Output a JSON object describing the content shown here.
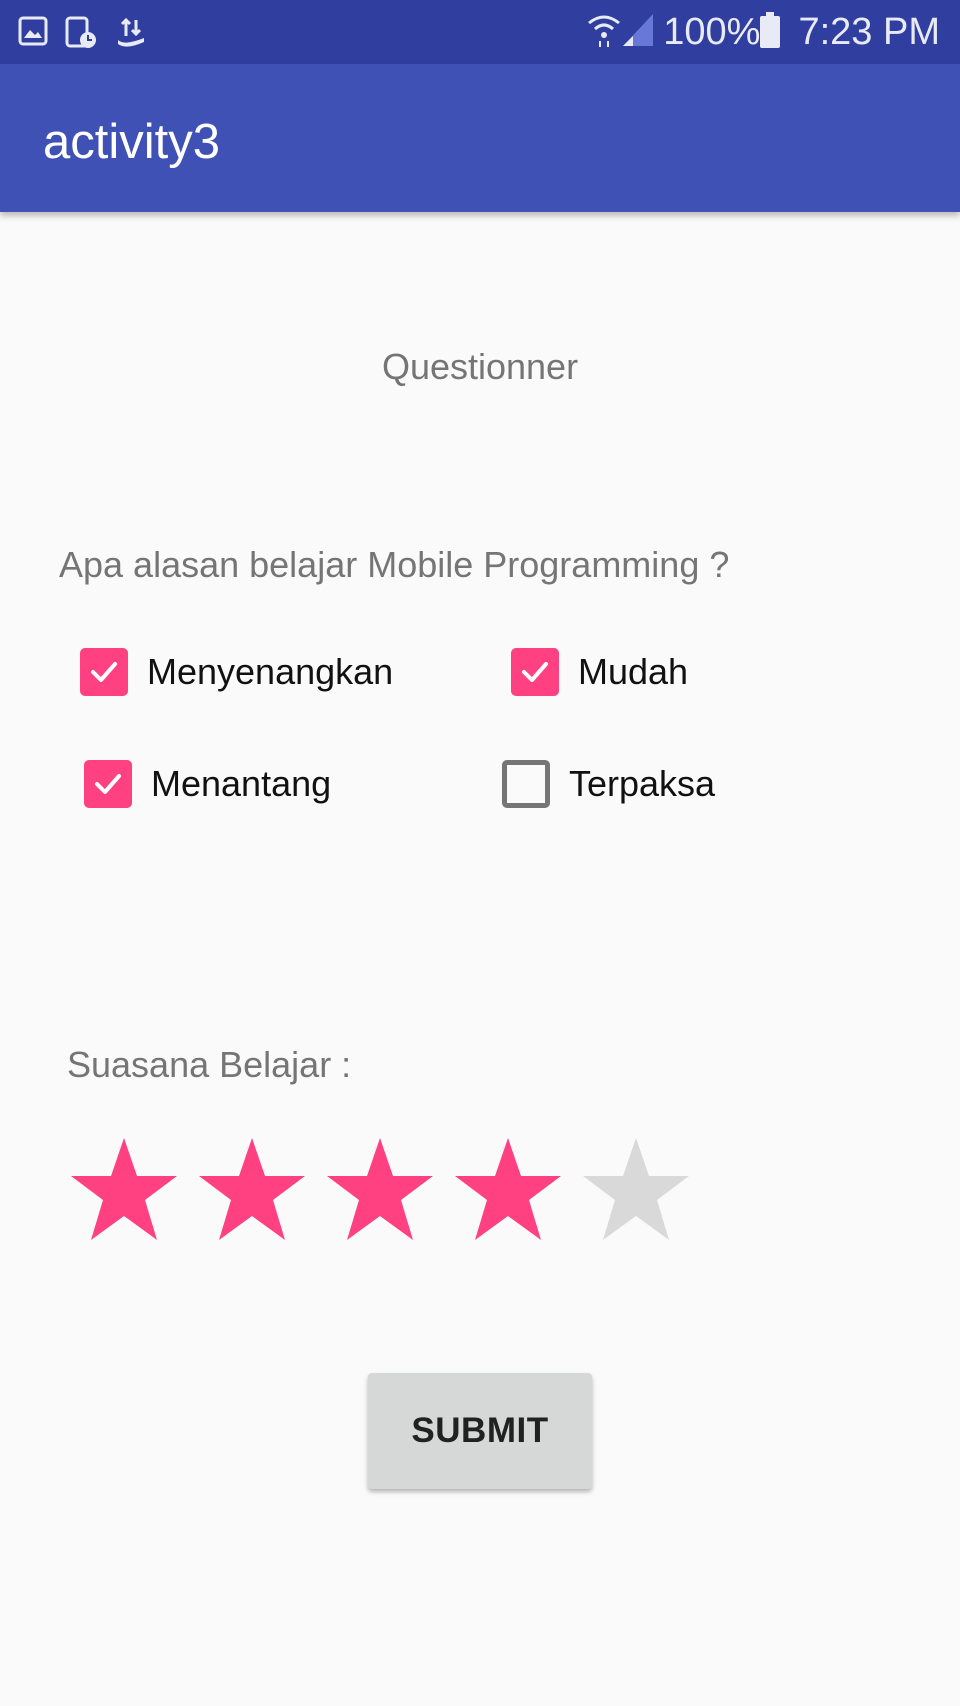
{
  "status_bar": {
    "battery_percent": "100%",
    "time": "7:23 PM",
    "icons": [
      "gallery-icon",
      "screenshot-timer-icon",
      "transfer-icon",
      "wifi-icon",
      "signal-icon",
      "battery-icon"
    ]
  },
  "app_bar": {
    "title": "activity3"
  },
  "page": {
    "section_title": "Questionner"
  },
  "question": {
    "text": "Apa alasan belajar Mobile Programming ?",
    "options": [
      {
        "label": "Menyenangkan",
        "checked": true
      },
      {
        "label": "Mudah",
        "checked": true
      },
      {
        "label": "Menantang",
        "checked": true
      },
      {
        "label": "Terpaksa",
        "checked": false
      }
    ]
  },
  "rating": {
    "label": "Suasana Belajar :",
    "value": 4,
    "max": 5
  },
  "submit": {
    "label": "SUBMIT"
  },
  "colors": {
    "status_bar": "#303f9f",
    "app_bar": "#3f51b5",
    "accent": "#ff4081",
    "star_empty": "#d9d9d9"
  }
}
